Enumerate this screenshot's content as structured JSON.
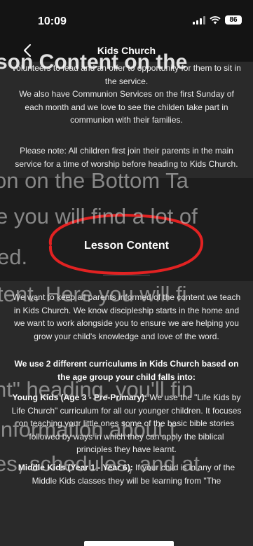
{
  "status": {
    "time": "10:09",
    "battery": "86"
  },
  "nav": {
    "title": "Kids Church"
  },
  "content": {
    "intro_partial": "volunteers to lead and an offer to opportunity for them to sit in the service.",
    "intro_communion": "We also have Communion Services on the first Sunday of each month and we love to see the childen take part in communion with their families.",
    "please_note": "Please note: All children first join their parents in the main service for a time of worship before heading to Kids Church.",
    "lesson_heading": "Lesson Content",
    "lesson_intro": "We want to keep all parents informed of the content we teach in Kids Church. We know discipleship starts in the home and we want to work alongside you to ensure we are helping you grow your child's knowledge and love of the word.",
    "curriculum_intro": "We use 2 different curriculums in Kids Church based on the age group your child falls into:",
    "young_kids_label": "Young Kids (Age 3 - Pre-Primary):",
    "young_kids_text": " We use the \"Life Kids by Life Church\" curriculum for all our younger children. It focuses on teaching your little ones some of the basic bible stories followed by ways in which they can apply the biblical principles they have learnt.",
    "middle_kids_label": "Middle Kids (Year 1 - Year 6):",
    "middle_kids_text": " If your child is in any of the Middle Kids classes they will be learning from \"The"
  },
  "overlay": {
    "line1": "son Content on the",
    "line2": "on on the Bottom Ta",
    "line3": "e you will find a lot of",
    "line4": "ed.",
    "line5": "tent. Here you will fi",
    "line6": "nt\" heading, you'll fin",
    "line7": "information about t",
    "line8": "es, schedules, and at"
  }
}
